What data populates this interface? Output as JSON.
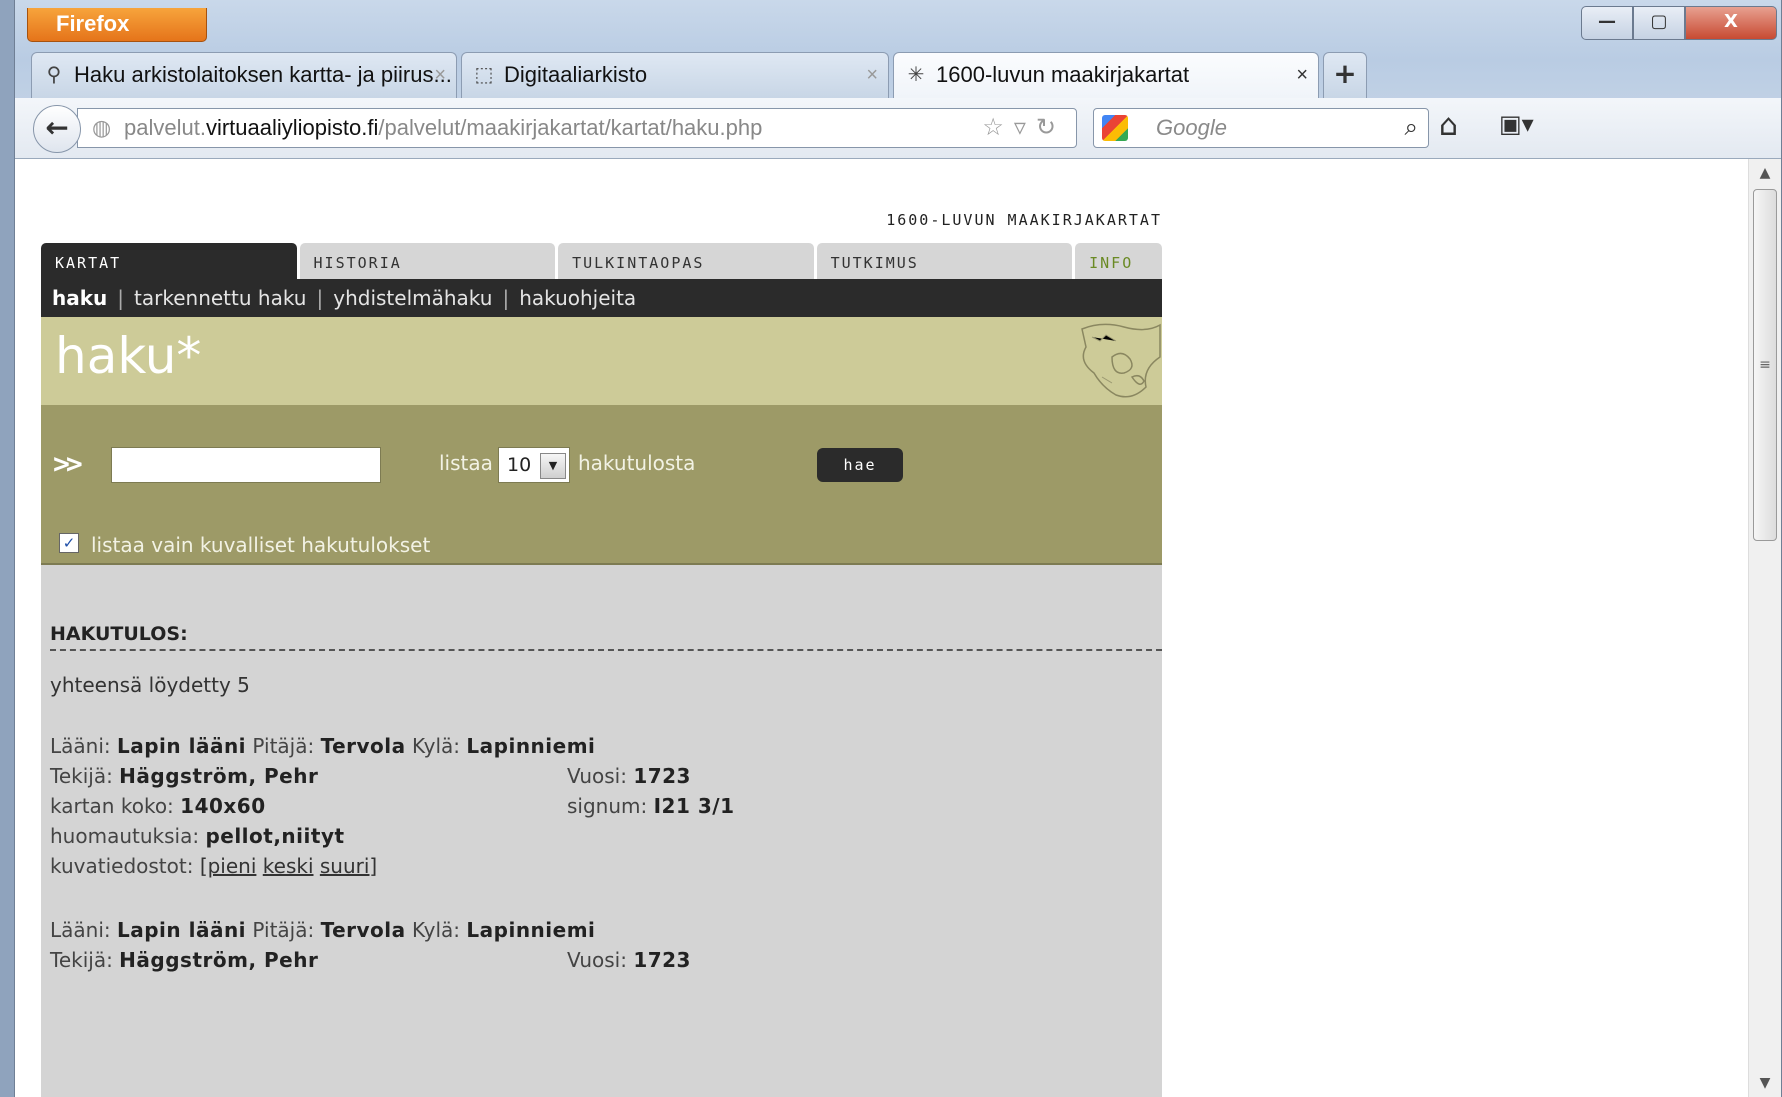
{
  "browser": {
    "menu_button": "Firefox",
    "window_controls": {
      "minimize": "—",
      "maximize": "▢",
      "close": "X"
    },
    "tabs": [
      {
        "icon": "map-search-icon",
        "title": "Haku arkistolaitoksen kartta- ja piirus...",
        "close": "×"
      },
      {
        "icon": "blank-page-icon",
        "title": "Digitaaliarkisto",
        "close": "×"
      },
      {
        "icon": "loading-icon",
        "title": "1600-luvun maakirjakartat",
        "close": "×"
      }
    ],
    "new_tab": "+",
    "url": {
      "prefix": "palvelut.",
      "domain": "virtuaaliyliopisto.fi",
      "path": "/palvelut/maakirjakartat/kartat/haku.php"
    },
    "search_placeholder": "Google"
  },
  "page": {
    "site_title": "1600-luvun maakirjakartat",
    "main_tabs": [
      "kartat",
      "historia",
      "tulkintaopas",
      "tutkimus",
      "info"
    ],
    "subnav": {
      "current": "haku",
      "items": [
        "tarkennettu haku",
        "yhdistelmähaku",
        "hakuohjeita"
      ]
    },
    "hero_title": "haku*",
    "search": {
      "arrows": ">>",
      "query_value": "",
      "listaa_label": "listaa",
      "count_value": "10",
      "hakutulosta_label": "hakutulosta",
      "submit_label": "hae",
      "only_images_checked": true,
      "only_images_label": "listaa vain kuvalliset hakutulokset"
    },
    "results": {
      "heading": "HAKUTULOS:",
      "total_text": "yhteensä löydetty 5",
      "records": [
        {
          "laani_label": "Lääni:",
          "laani": "Lapin lääni",
          "pitaja_label": "Pitäjä:",
          "pitaja": "Tervola",
          "kyla_label": "Kylä:",
          "kyla": "Lapinniemi",
          "tekija_label": "Tekijä:",
          "tekija": "Häggström, Pehr",
          "vuosi_label": "Vuosi:",
          "vuosi": "1723",
          "koko_label": "kartan koko:",
          "koko": "140x60",
          "signum_label": "signum:",
          "signum": "I21 3/1",
          "huom_label": "huomautuksia:",
          "huom": "pellot,niityt",
          "kuvat_label": "kuvatiedostot:",
          "kuvat_open": "[pieni",
          "kuvat_mid": "keski",
          "kuvat_close": "suuri]"
        },
        {
          "laani_label": "Lääni:",
          "laani": "Lapin lääni",
          "pitaja_label": "Pitäjä:",
          "pitaja": "Tervola",
          "kyla_label": "Kylä:",
          "kyla": "Lapinniemi",
          "tekija_label": "Tekijä:",
          "tekija": "Häggström, Pehr",
          "vuosi_label": "Vuosi:",
          "vuosi": "1723"
        }
      ]
    }
  }
}
